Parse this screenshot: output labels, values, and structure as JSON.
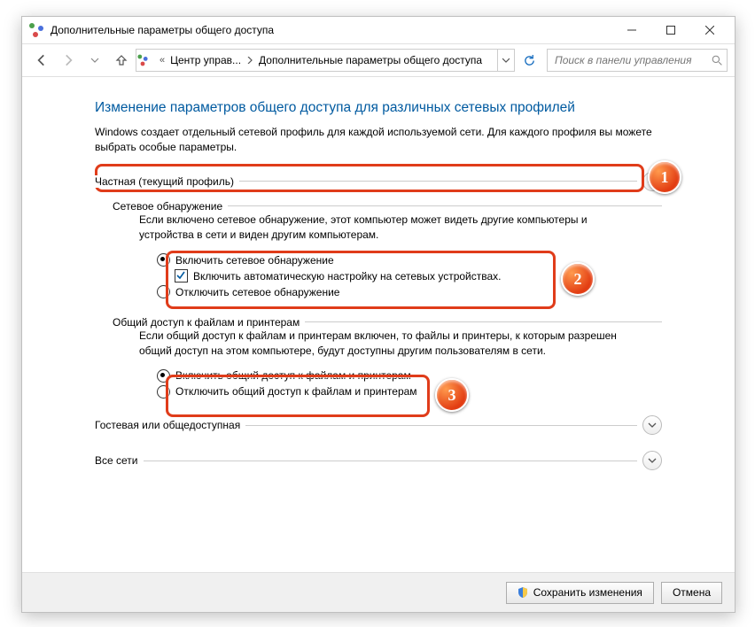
{
  "window": {
    "title": "Дополнительные параметры общего доступа"
  },
  "nav": {
    "crumb_prefix": "«",
    "crumb1": "Центр управ...",
    "crumb2": "Дополнительные параметры общего доступа",
    "search_placeholder": "Поиск в панели управления"
  },
  "page": {
    "title": "Изменение параметров общего доступа для различных сетевых профилей",
    "description": "Windows создает отдельный сетевой профиль для каждой используемой сети. Для каждого профиля вы можете выбрать особые параметры."
  },
  "sections": {
    "private": {
      "header": "Частная (текущий профиль)",
      "discovery": {
        "group_label": "Сетевое обнаружение",
        "explain": "Если включено сетевое обнаружение, этот компьютер может видеть другие компьютеры и устройства в сети и виден другим компьютерам.",
        "enable": "Включить сетевое обнаружение",
        "auto": "Включить автоматическую настройку на сетевых устройствах.",
        "disable": "Отключить сетевое обнаружение"
      },
      "sharing": {
        "group_label": "Общий доступ к файлам и принтерам",
        "explain": "Если общий доступ к файлам и принтерам включен, то файлы и принтеры, к которым разрешен общий доступ на этом компьютере, будут доступны другим пользователям в сети.",
        "enable": "Включить общий доступ к файлам и принтерам",
        "disable": "Отключить общий доступ к файлам и принтерам"
      }
    },
    "guest": {
      "header": "Гостевая или общедоступная"
    },
    "all": {
      "header": "Все сети"
    }
  },
  "footer": {
    "save": "Сохранить изменения",
    "cancel": "Отмена"
  },
  "annotations": {
    "b1": "1",
    "b2": "2",
    "b3": "3"
  }
}
